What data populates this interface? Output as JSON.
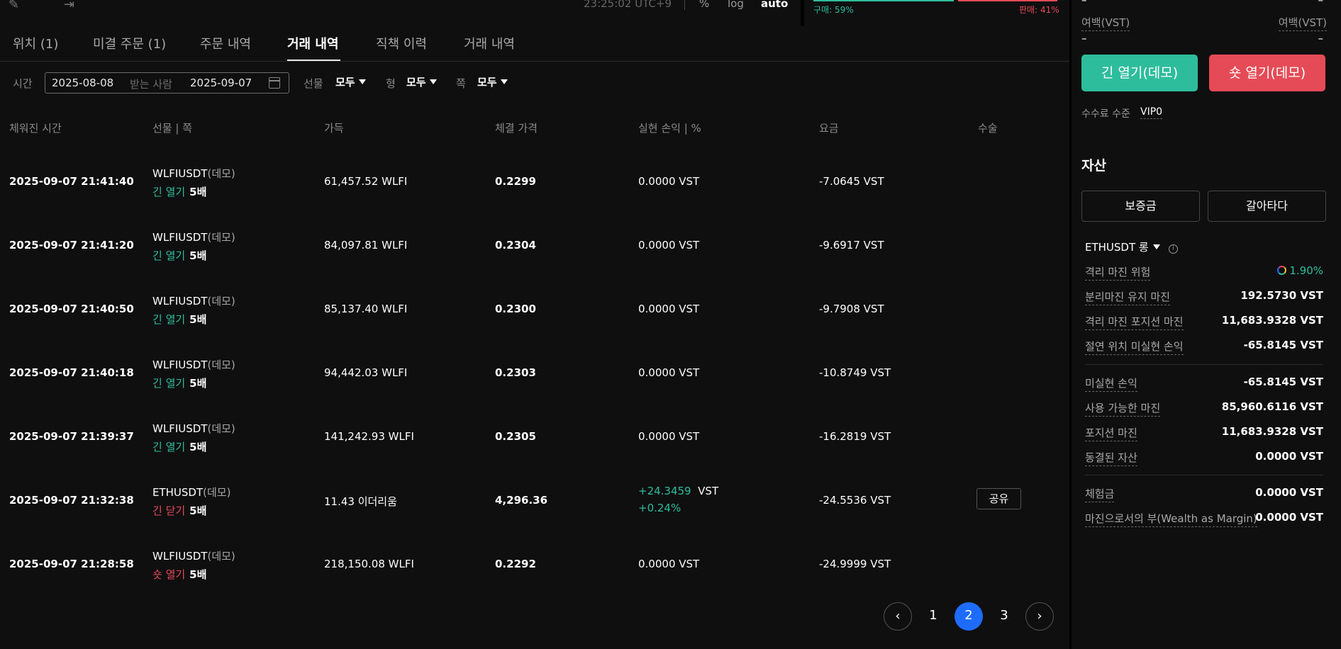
{
  "topbar": {
    "clock": "23:25:02 UTC+9",
    "percent_label": "%",
    "log_label": "log",
    "auto_label": "auto",
    "buy_ratio": "구매: 59%",
    "sell_ratio": "판매: 41%"
  },
  "tabs": [
    {
      "label": "위치 (1)"
    },
    {
      "label": "미결 주문 (1)"
    },
    {
      "label": "주문 내역"
    },
    {
      "label": "거래 내역"
    },
    {
      "label": "직책 이력"
    },
    {
      "label": "거래 내역"
    }
  ],
  "filters": {
    "time_label": "시간",
    "date_from": "2025-08-08",
    "date_mid": "받는 사람",
    "date_to": "2025-09-07",
    "futures_label": "선물",
    "futures_value": "모두",
    "type_label": "형",
    "type_value": "모두",
    "side_label": "쪽",
    "side_value": "모두"
  },
  "table": {
    "headers": [
      "체워진 시간",
      "선물 | 쪽",
      "가득",
      "체결 가격",
      "실현 손익 | %",
      "요금",
      "수술"
    ],
    "rows": [
      {
        "time": "2025-09-07 21:41:40",
        "symbol": "WLFIUSDT",
        "demo": "(데모)",
        "side": "긴 열기",
        "leverage": "5배",
        "qty": "61,457.52  WLFI",
        "price": "0.2299",
        "pnl": "0.0000  VST",
        "pnl_pct": "",
        "fee": "-7.0645 VST"
      },
      {
        "time": "2025-09-07 21:41:20",
        "symbol": "WLFIUSDT",
        "demo": "(데모)",
        "side": "긴 열기",
        "leverage": "5배",
        "qty": "84,097.81  WLFI",
        "price": "0.2304",
        "pnl": "0.0000  VST",
        "pnl_pct": "",
        "fee": "-9.6917 VST"
      },
      {
        "time": "2025-09-07 21:40:50",
        "symbol": "WLFIUSDT",
        "demo": "(데모)",
        "side": "긴 열기",
        "leverage": "5배",
        "qty": "85,137.40  WLFI",
        "price": "0.2300",
        "pnl": "0.0000  VST",
        "pnl_pct": "",
        "fee": "-9.7908 VST"
      },
      {
        "time": "2025-09-07 21:40:18",
        "symbol": "WLFIUSDT",
        "demo": "(데모)",
        "side": "긴 열기",
        "leverage": "5배",
        "qty": "94,442.03  WLFI",
        "price": "0.2303",
        "pnl": "0.0000  VST",
        "pnl_pct": "",
        "fee": "-10.8749 VST"
      },
      {
        "time": "2025-09-07 21:39:37",
        "symbol": "WLFIUSDT",
        "demo": "(데모)",
        "side": "긴 열기",
        "leverage": "5배",
        "qty": "141,242.93  WLFI",
        "price": "0.2305",
        "pnl": "0.0000  VST",
        "pnl_pct": "",
        "fee": "-16.2819 VST"
      },
      {
        "time": "2025-09-07 21:32:38",
        "symbol": "ETHUSDT",
        "demo": "(데모)",
        "side": "긴 닫기",
        "leverage": "5배",
        "qty": "11.43  이더리움",
        "price": "4,296.36",
        "pnl": "+24.3459",
        "pnl_unit": "VST",
        "pnl_pct": "+0.24%",
        "fee": "-24.5536 VST",
        "share": "공유"
      },
      {
        "time": "2025-09-07 21:28:58",
        "symbol": "WLFIUSDT",
        "demo": "(데모)",
        "side": "숏 열기",
        "leverage": "5배",
        "qty": "218,150.08  WLFI",
        "price": "0.2292",
        "pnl": "0.0000  VST",
        "pnl_pct": "",
        "fee": "-24.9999 VST"
      }
    ]
  },
  "pagination": {
    "prev": "‹",
    "pages": [
      "1",
      "2",
      "3"
    ],
    "current": "2",
    "next": "›"
  },
  "sidebar": {
    "dash_top_left": "–",
    "dash_top_right": "–",
    "margin_label_left": "여백(VST)",
    "margin_label_right": "여백(VST)",
    "margin_value_left": "–",
    "margin_value_right": "–",
    "open_long": "긴 열기(데모)",
    "open_short": "숏 열기(데모)",
    "fee_level_label": "수수료 수준",
    "fee_level_value": "VIP0",
    "assets_title": "자산",
    "deposit_button": "보증금",
    "transfer_button": "갈아타다",
    "position_symbol": "ETHUSDT 롱",
    "metrics": [
      {
        "label": "격리 마진 위험",
        "value": "1.90%"
      },
      {
        "label": "분리마진 유지 마진",
        "value": "192.5730 VST"
      },
      {
        "label": "격리 마진 포지션 마진",
        "value": "11,683.9328 VST"
      },
      {
        "label": "절연 위치 미실현 손익",
        "value": "-65.8145 VST"
      }
    ],
    "account": [
      {
        "label": "미실현 손익",
        "value": "-65.8145 VST"
      },
      {
        "label": "사용 가능한 마진",
        "value": "85,960.6116 VST"
      },
      {
        "label": "포지션 마진",
        "value": "11,683.9328 VST"
      },
      {
        "label": "동결된 자산",
        "value": "0.0000 VST"
      }
    ],
    "bonus": [
      {
        "label": "체험금",
        "value": "0.0000 VST"
      },
      {
        "label": "마진으로서의 부(Wealth as Margin)",
        "value": "0.0000 VST"
      }
    ]
  },
  "colors": {
    "green": "#2ebd9c",
    "red": "#e54b56",
    "blue": "#1e6cff"
  }
}
